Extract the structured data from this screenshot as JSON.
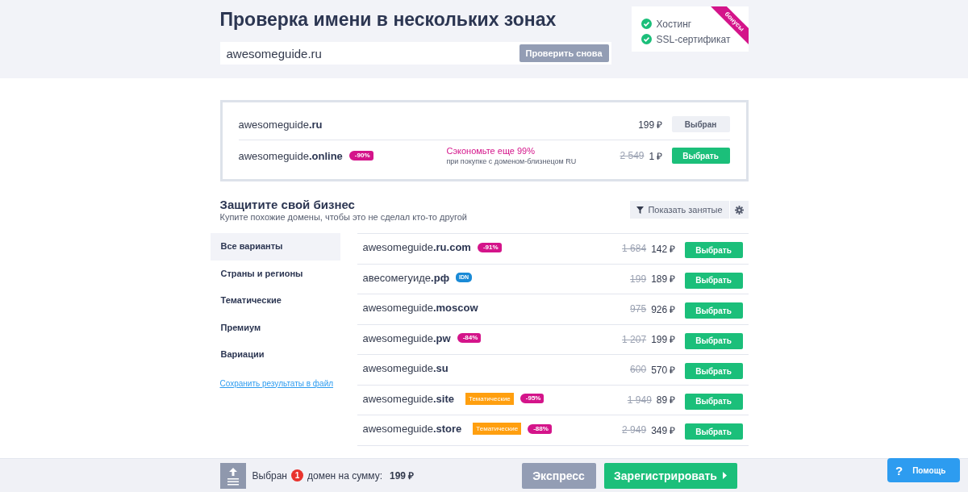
{
  "header": {
    "title": "Проверка имени в нескольких зонах",
    "search": {
      "value": "awesomeguide.ru",
      "button": "Проверить снова"
    },
    "bonus": {
      "ribbon": "бонусы",
      "items": [
        {
          "label": "Хостинг",
          "checked": true
        },
        {
          "label": "SSL-сертификат",
          "checked": true
        }
      ]
    }
  },
  "chosen": [
    {
      "name": "awesomeguide",
      "zone": ".ru",
      "price": "199 ₽",
      "button": "Выбран",
      "selected": true
    },
    {
      "name": "awesomeguide",
      "zone": ".online",
      "tags": [
        {
          "kind": "discount",
          "text": "-90%"
        }
      ],
      "promo": {
        "title": "Сэкономьте еще 99%",
        "note": "при покупке с доменом-близнецом RU"
      },
      "old_price": "2 549",
      "price": "1 ₽",
      "button": "Выбрать",
      "selected": false
    }
  ],
  "protect": {
    "title": "Защитите свой бизнес",
    "subtitle": "Купите похожие домены, чтобы это не сделал кто-то другой",
    "filter": "Показать занятые"
  },
  "sidebar": {
    "items": [
      {
        "label": "Все варианты",
        "selected": true
      },
      {
        "label": "Страны и регионы",
        "selected": false
      },
      {
        "label": "Тематические",
        "selected": false
      },
      {
        "label": "Премиум",
        "selected": false
      },
      {
        "label": "Вариации",
        "selected": false
      }
    ],
    "link": "Сохранить результаты в файл"
  },
  "domains": [
    {
      "name": "awesomeguide",
      "zone": ".ru.com",
      "tags": [
        {
          "kind": "discount",
          "text": "-91%"
        }
      ],
      "old_price": "1 684",
      "price": "142 ₽",
      "button": "Выбрать",
      "selected": false
    },
    {
      "name": "авесомегуиде",
      "zone": ".рф",
      "tags": [
        {
          "kind": "idn",
          "text": "IDN"
        }
      ],
      "old_price": "199",
      "price": "189 ₽",
      "button": "Выбрать",
      "selected": false
    },
    {
      "name": "awesomeguide",
      "zone": ".moscow",
      "old_price": "975",
      "price": "926 ₽",
      "button": "Выбрать",
      "selected": false
    },
    {
      "name": "awesomeguide",
      "zone": ".pw",
      "tags": [
        {
          "kind": "discount",
          "text": "-84%"
        }
      ],
      "old_price": "1 207",
      "price": "199 ₽",
      "button": "Выбрать",
      "selected": false
    },
    {
      "name": "awesomeguide",
      "zone": ".su",
      "old_price": "600",
      "price": "570 ₽",
      "button": "Выбрать",
      "selected": false
    },
    {
      "name": "awesomeguide",
      "zone": ".site",
      "tags": [
        {
          "kind": "category",
          "text": "Тематические"
        },
        {
          "kind": "discount",
          "text": "-95%"
        }
      ],
      "old_price": "1 949",
      "price": "89 ₽",
      "button": "Выбрать",
      "selected": false
    },
    {
      "name": "awesomeguide",
      "zone": ".store",
      "tags": [
        {
          "kind": "category",
          "text": "Тематические"
        },
        {
          "kind": "discount",
          "text": "-88%"
        }
      ],
      "old_price": "2 949",
      "price": "349 ₽",
      "button": "Выбрать",
      "selected": false
    }
  ],
  "footer": {
    "before": "Выбран",
    "count": "1",
    "after": "домен на сумму:",
    "total": "199 ₽",
    "express": "Экспресс",
    "register": "Зарегистрировать"
  },
  "help": {
    "icon": "?",
    "label": "Помощь"
  }
}
